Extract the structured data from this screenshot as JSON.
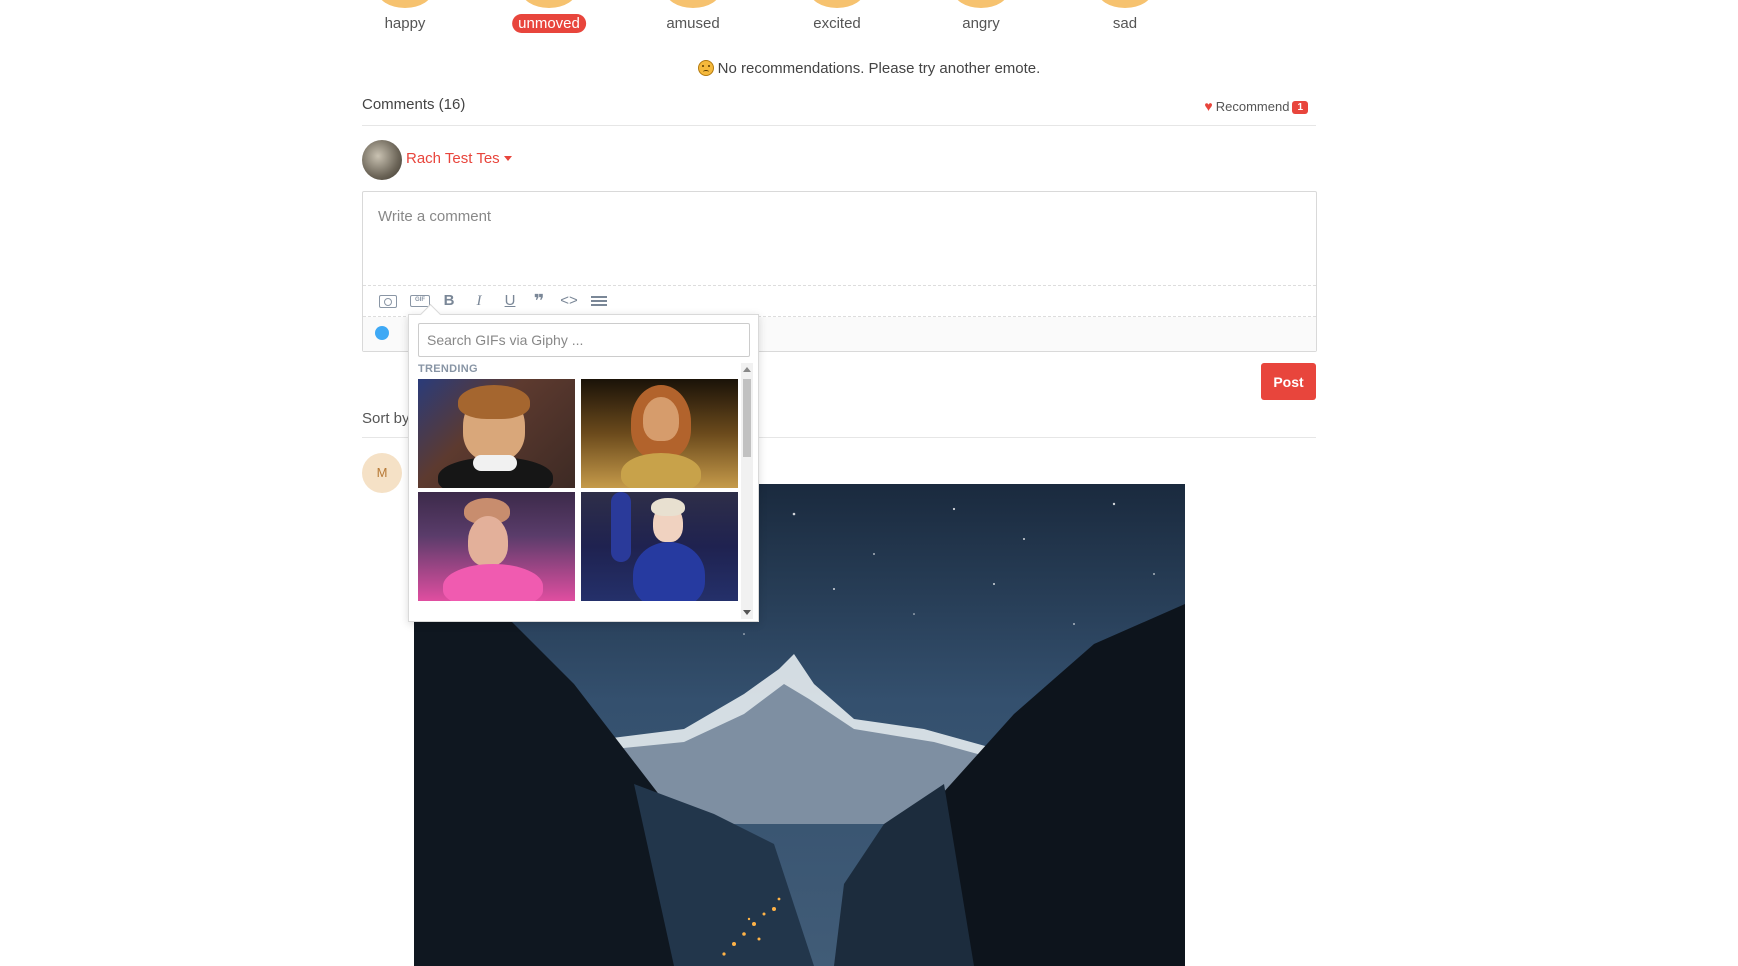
{
  "reactions": [
    {
      "label": "happy",
      "active": false
    },
    {
      "label": "unmoved",
      "active": true
    },
    {
      "label": "amused",
      "active": false
    },
    {
      "label": "excited",
      "active": false
    },
    {
      "label": "angry",
      "active": false
    },
    {
      "label": "sad",
      "active": false
    }
  ],
  "recommendations": {
    "empty_text": "No recommendations. Please try another emote.",
    "icon": "sad-face-icon"
  },
  "comments": {
    "title": "Comments (16)",
    "recommend_label": "Recommend",
    "recommend_count": "1"
  },
  "user": {
    "name": "Rach Test Tes"
  },
  "editor": {
    "placeholder": "Write a comment",
    "toolbar": {
      "gif_label": "GIF",
      "bold": "B",
      "italic": "I",
      "underline": "U",
      "quote": "❞",
      "code": "<>"
    }
  },
  "gif_picker": {
    "search_placeholder": "Search GIFs via Giphy ...",
    "section_label": "TRENDING"
  },
  "post_label": "Post",
  "sort_label": "Sort by",
  "comment_avatar_initial": "M",
  "colors": {
    "accent": "#e8453c",
    "reaction_face": "#f6c26f",
    "link_blue": "#3fa9f5"
  }
}
